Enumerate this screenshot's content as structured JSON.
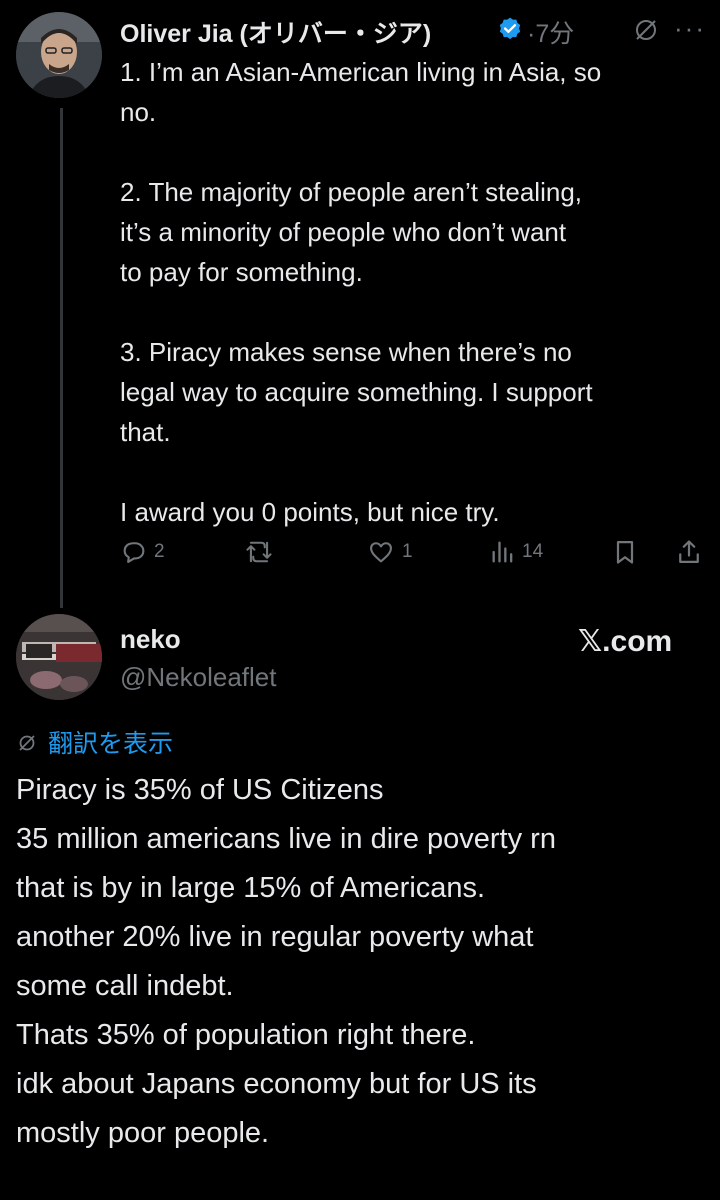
{
  "reply": {
    "author_name": "Oliver Jia (オリバー・ジア)",
    "separator": "·",
    "time": "7分",
    "more": "···",
    "paragraphs": [
      [
        "1. I’m an Asian-American living in Asia, so",
        "no."
      ],
      [
        "2. The majority of people aren’t stealing,",
        "it’s a minority of people who don’t want",
        "to pay for something."
      ],
      [
        "3. Piracy makes sense when there’s no",
        "legal way to acquire something. I support",
        "that."
      ],
      [
        "I award you 0 points, but nice try."
      ]
    ],
    "actions": {
      "replies": "2",
      "reposts": "",
      "likes": "1",
      "views": "14"
    },
    "icons": [
      "verified-badge-icon",
      "no-edit-icon",
      "more-icon",
      "reply-icon",
      "repost-icon",
      "like-icon",
      "views-icon",
      "bookmark-icon",
      "share-icon"
    ]
  },
  "quoted": {
    "name": "neko",
    "handle": "@Nekoleaflet",
    "source": "𝕏.com",
    "translate_label": "翻訳を表示",
    "lines": [
      "Piracy is 35% of US Citizens",
      "35 million americans live in dire poverty rn",
      "that is by in large 15% of Americans.",
      "another 20% live in regular poverty what",
      "some call indebt.",
      "Thats 35% of population right there.",
      "idk about Japans economy but for US its",
      "mostly poor people."
    ]
  },
  "colors": {
    "background": "#000000",
    "text": "#e7e9ea",
    "muted": "#71767b",
    "accent": "#1d9bf0"
  }
}
